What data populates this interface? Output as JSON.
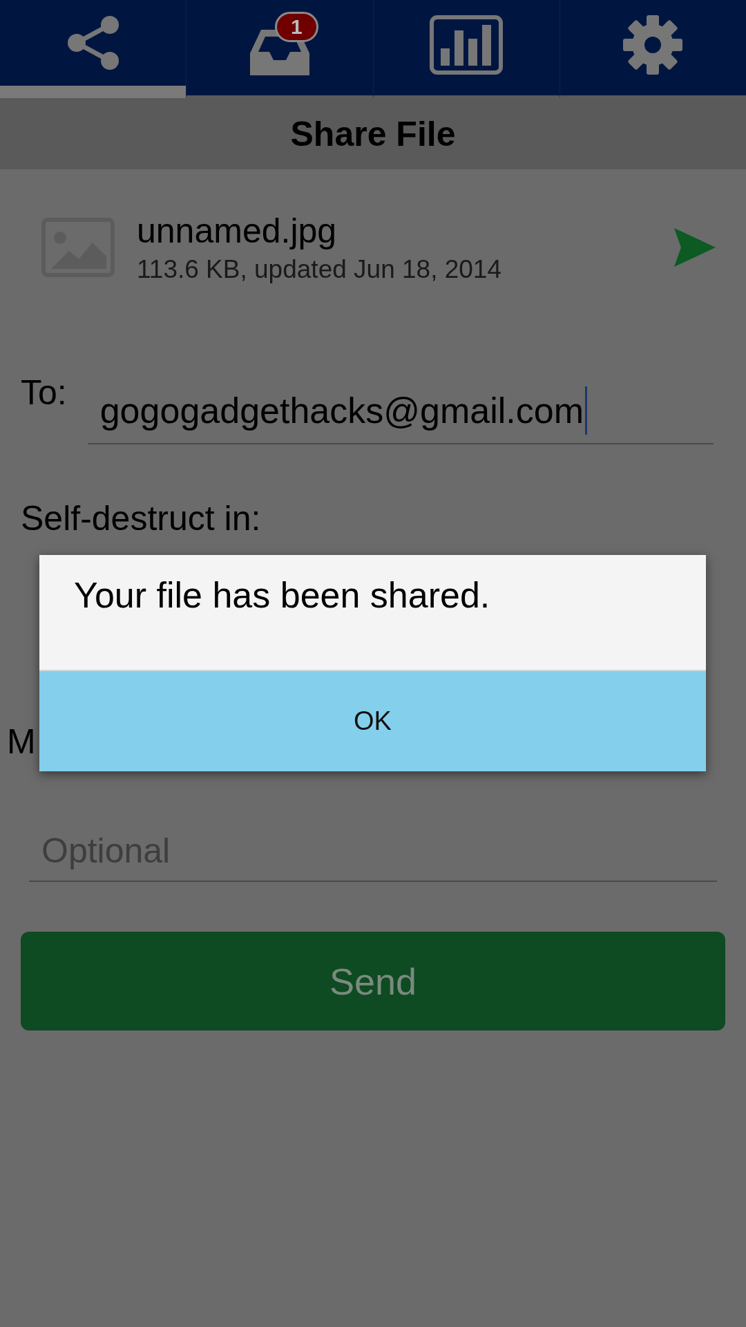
{
  "tabs": [
    {
      "kind": "share",
      "selected": true
    },
    {
      "kind": "inbox",
      "selected": false,
      "badge": "1"
    },
    {
      "kind": "stats",
      "selected": false
    },
    {
      "kind": "settings",
      "selected": false
    }
  ],
  "title": "Share File",
  "file": {
    "name": "unnamed.jpg",
    "details": "113.6 KB, updated Jun 18, 2014"
  },
  "to": {
    "label": "To:",
    "value": "gogogadgethacks@gmail.com"
  },
  "self_destruct": {
    "label": "Self-destruct in:"
  },
  "message": {
    "label": "M",
    "placeholder": "Optional"
  },
  "send_button": "Send",
  "dialog": {
    "message": "Your file has been shared.",
    "button": "OK"
  }
}
